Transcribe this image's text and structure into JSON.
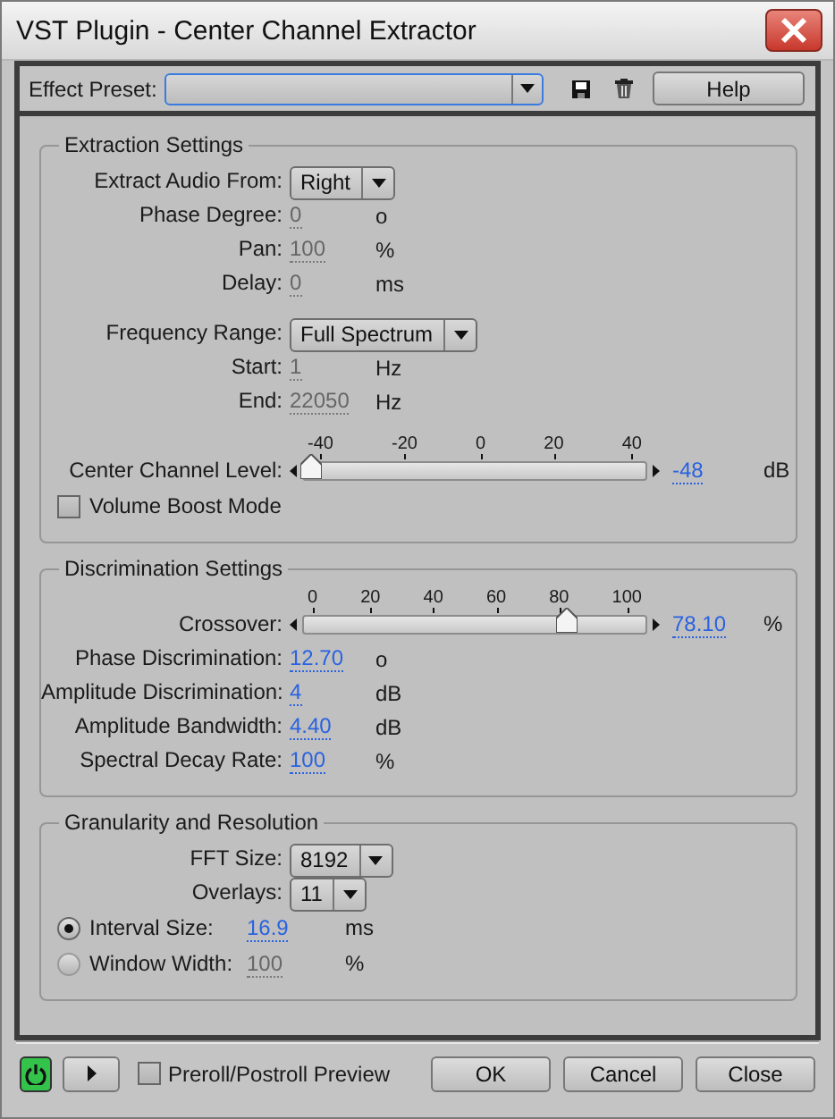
{
  "window": {
    "title": "VST Plugin - Center Channel Extractor"
  },
  "preset_bar": {
    "label": "Effect Preset:",
    "help_button": "Help"
  },
  "sections": [
    {
      "title": "Extraction Settings",
      "groups": [
        [
          {
            "kind": "dropdown",
            "label": "Extract Audio From:",
            "value": "Right"
          },
          {
            "kind": "number",
            "label": "Phase Degree:",
            "value": "0",
            "unit": "o",
            "disabled": true
          },
          {
            "kind": "number",
            "label": "Pan:",
            "value": "100",
            "unit": "%",
            "disabled": true
          },
          {
            "kind": "number",
            "label": "Delay:",
            "value": "0",
            "unit": "ms",
            "disabled": true
          }
        ],
        [
          {
            "kind": "dropdown",
            "label": "Frequency Range:",
            "value": "Full Spectrum"
          },
          {
            "kind": "number",
            "label": "Start:",
            "value": "1",
            "unit": "Hz",
            "disabled": true
          },
          {
            "kind": "number",
            "label": "End:",
            "value": "22050",
            "unit": "Hz",
            "disabled": true
          }
        ],
        [
          {
            "kind": "slider",
            "label": "Center Channel Level:",
            "ticks": [
              "-40",
              "-20",
              "0",
              "20",
              "40"
            ],
            "level": 0.02,
            "reading": "-48",
            "unit": "dB"
          },
          {
            "kind": "checkbox",
            "label": "Volume Boost Mode",
            "checked": false
          }
        ]
      ]
    },
    {
      "title": "Discrimination Settings",
      "groups": [
        [
          {
            "kind": "slider",
            "label": "Crossover:",
            "ticks": [
              "0",
              "20",
              "40",
              "60",
              "80",
              "100"
            ],
            "level": 0.77,
            "reading": "78.10",
            "unit": "%"
          },
          {
            "kind": "number",
            "label": "Phase Discrimination:",
            "value": "12.70",
            "unit": "o",
            "disabled": false
          },
          {
            "kind": "number",
            "label": "Amplitude Discrimination:",
            "value": "4",
            "unit": "dB",
            "disabled": false
          },
          {
            "kind": "number",
            "label": "Amplitude Bandwidth:",
            "value": "4.40",
            "unit": "dB",
            "disabled": false
          },
          {
            "kind": "number",
            "label": "Spectral Decay Rate:",
            "value": "100",
            "unit": "%",
            "disabled": false
          }
        ]
      ]
    },
    {
      "title": "Granularity and Resolution",
      "groups": [
        [
          {
            "kind": "dropdown",
            "label": "FFT Size:",
            "value": "8192"
          },
          {
            "kind": "dropdown",
            "label": "Overlays:",
            "value": "11"
          },
          {
            "kind": "radio",
            "label": "Interval Size:",
            "value": "16.9",
            "unit": "ms",
            "selected": true,
            "disabled": false
          },
          {
            "kind": "radio",
            "label": "Window Width:",
            "value": "100",
            "unit": "%",
            "selected": false,
            "disabled": true
          }
        ]
      ]
    }
  ],
  "footer": {
    "power_on": true,
    "preview": {
      "label": "Preroll/Postroll Preview",
      "checked": false
    },
    "buttons": [
      "OK",
      "Cancel",
      "Close"
    ]
  }
}
